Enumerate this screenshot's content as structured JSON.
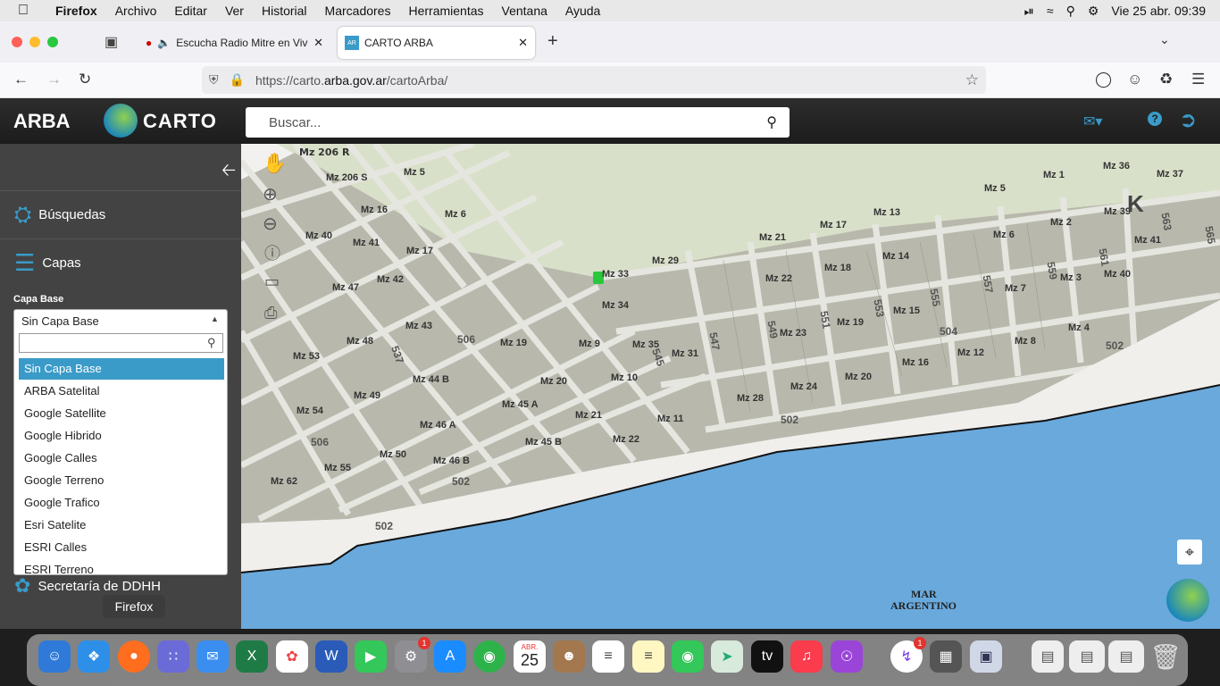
{
  "menubar": {
    "app": "Firefox",
    "items": [
      "Archivo",
      "Editar",
      "Ver",
      "Historial",
      "Marcadores",
      "Herramientas",
      "Ventana",
      "Ayuda"
    ],
    "clock": "Vie 25 abr.  09:39"
  },
  "tabs": [
    {
      "label": "Escucha Radio Mitre en Vivo"
    },
    {
      "label": "CARTO ARBA"
    }
  ],
  "url": {
    "prefix": "https://carto.",
    "domain": "arba.gov.ar",
    "path": "/cartoArba/"
  },
  "app": {
    "logo_arba": "ARBA",
    "logo_carto": "CARTO",
    "search_placeholder": "Buscar..."
  },
  "sidebar": {
    "busquedas": "Búsquedas",
    "capas": "Capas",
    "capa_base_label": "Capa Base",
    "selected": "Sin Capa Base",
    "options": [
      "Sin Capa Base",
      "ARBA Satelital",
      "Google Satellite",
      "Google Hibrido",
      "Google Calles",
      "Google Terreno",
      "Google Trafico",
      "Esri Satelite",
      "ESRI Calles",
      "ESRI Terreno"
    ],
    "secretaria": "Secretaría de DDHH"
  },
  "map": {
    "sea_label_1": "MAR",
    "sea_label_2": "ARGENTINO",
    "big_letter": "K",
    "blocks": [
      "Mz 206 R",
      "Mz 206 S",
      "Mz 5",
      "Mz 16",
      "Mz 6",
      "Mz 40",
      "Mz 41",
      "Mz 17",
      "Mz 47",
      "Mz 42",
      "Mz 43",
      "Mz 48",
      "Mz 19",
      "Mz 9",
      "Mz 53",
      "Mz 44 B",
      "Mz 20",
      "Mz 10",
      "Mz 49",
      "Mz 45 A",
      "Mz 54",
      "Mz 46 A",
      "Mz 21",
      "Mz 11",
      "Mz 45 B",
      "Mz 50",
      "Mz 46 B",
      "Mz 22",
      "Mz 55",
      "Mz 62",
      "Mz 33",
      "Mz 34",
      "Mz 35",
      "Mz 31",
      "Mz 29",
      "Mz 21",
      "Mz 22",
      "Mz 23",
      "Mz 28",
      "Mz 24",
      "Mz 17",
      "Mz 18",
      "Mz 19",
      "Mz 20",
      "Mz 13",
      "Mz 14",
      "Mz 15",
      "Mz 16",
      "Mz 5",
      "Mz 6",
      "Mz 7",
      "Mz 12",
      "Mz 8",
      "Mz 1",
      "Mz 2",
      "Mz 3",
      "Mz 4",
      "Mz 36",
      "Mz 37",
      "Mz 41",
      "Mz 40",
      "Mz 39"
    ],
    "streets": [
      "502",
      "502",
      "502",
      "502",
      "504",
      "506",
      "506",
      "537",
      "545",
      "547",
      "549",
      "551",
      "553",
      "555",
      "557",
      "559",
      "561",
      "563",
      "565"
    ]
  },
  "dock": {
    "tooltip": "Firefox",
    "calendar_month": "ABR.",
    "calendar_day": "25",
    "badges": [
      "1",
      "1"
    ]
  }
}
